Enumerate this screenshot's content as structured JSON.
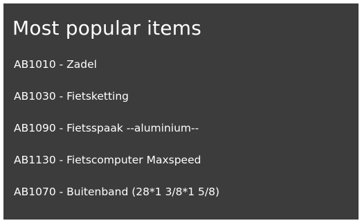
{
  "tile": {
    "title": "Most popular items",
    "background": "#3c3c3c",
    "text_color": "#ffffff",
    "items": [
      {
        "label": "AB1010 - Zadel"
      },
      {
        "label": "AB1030 - Fietsketting"
      },
      {
        "label": "AB1090 - Fietsspaak --aluminium--"
      },
      {
        "label": "AB1130 - Fietscomputer Maxspeed"
      },
      {
        "label": "AB1070 - Buitenband (28*1 3/8*1 5/8)"
      }
    ]
  }
}
